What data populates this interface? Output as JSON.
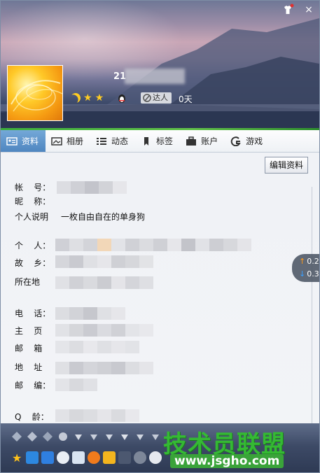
{
  "window": {
    "buttons": {
      "skin": "skin-icon",
      "close": "×"
    }
  },
  "profile": {
    "nickname_prefix": "21",
    "talent_label": "达人",
    "days": "0天"
  },
  "tabs": [
    {
      "label": "资料",
      "icon": "profile-card-icon",
      "active": true
    },
    {
      "label": "相册",
      "icon": "photo-icon",
      "active": false
    },
    {
      "label": "动态",
      "icon": "list-icon",
      "active": false
    },
    {
      "label": "标签",
      "icon": "bookmark-icon",
      "active": false
    },
    {
      "label": "账户",
      "icon": "briefcase-icon",
      "active": false
    },
    {
      "label": "游戏",
      "icon": "game-icon",
      "active": false
    }
  ],
  "edit_button": "编辑资料",
  "fields": {
    "account": {
      "label": "帐    号："
    },
    "nickname": {
      "label": "昵    称："
    },
    "desc": {
      "label": "个人说明",
      "value": "一枚自由自在的单身狗"
    },
    "personal": {
      "label": "个    人："
    },
    "hometown": {
      "label": "故    乡："
    },
    "location": {
      "label": "所在地"
    },
    "phone": {
      "label": "电    话："
    },
    "homepage": {
      "label": "主    页"
    },
    "email": {
      "label": "邮    箱"
    },
    "address": {
      "label": "地    址"
    },
    "zipcode": {
      "label": "邮    编："
    },
    "age": {
      "label": "Q    龄："
    }
  },
  "speed": {
    "up": "0.2",
    "down": "0.3"
  },
  "watermark": {
    "title": "技术员联盟",
    "url": "www.jsgho.com"
  },
  "colors": {
    "accent_tab": "#5a90c8",
    "green": "#35b934"
  }
}
